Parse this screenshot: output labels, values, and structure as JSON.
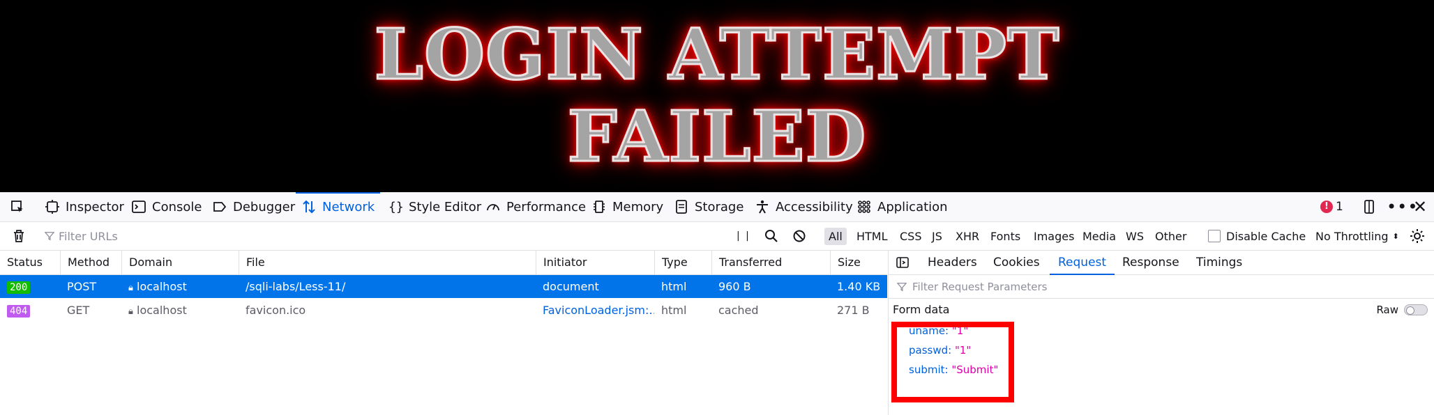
{
  "banner": {
    "line1": "LOGIN ATTEMPT",
    "line2": "FAILED"
  },
  "toolbar": {
    "tabs": [
      {
        "label": "Inspector",
        "icon": "inspector-icon"
      },
      {
        "label": "Console",
        "icon": "console-icon"
      },
      {
        "label": "Debugger",
        "icon": "debugger-icon"
      },
      {
        "label": "Network",
        "icon": "network-icon",
        "selected": true
      },
      {
        "label": "Style Editor",
        "icon": "style-editor-icon"
      },
      {
        "label": "Performance",
        "icon": "performance-icon"
      },
      {
        "label": "Memory",
        "icon": "memory-icon"
      },
      {
        "label": "Storage",
        "icon": "storage-icon"
      },
      {
        "label": "Accessibility",
        "icon": "accessibility-icon"
      },
      {
        "label": "Application",
        "icon": "application-icon"
      }
    ],
    "error_count": "1"
  },
  "filterbar": {
    "placeholder": "Filter URLs",
    "types": [
      "All",
      "HTML",
      "CSS",
      "JS",
      "XHR",
      "Fonts",
      "Images",
      "Media",
      "WS",
      "Other"
    ],
    "selected_type": "All",
    "disable_cache_label": "Disable Cache",
    "throttling": "No Throttling"
  },
  "table": {
    "columns": [
      "Status",
      "Method",
      "Domain",
      "File",
      "Initiator",
      "Type",
      "Transferred",
      "Size"
    ],
    "rows": [
      {
        "status": "200",
        "method": "POST",
        "domain": "localhost",
        "file": "/sqli-labs/Less-11/",
        "initiator": "document",
        "type": "html",
        "transferred": "960 B",
        "size": "1.40 KB"
      },
      {
        "status": "404",
        "method": "GET",
        "domain": "localhost",
        "file": "favicon.ico",
        "initiator": "FaviconLoader.jsm:…",
        "type": "html",
        "transferred": "cached",
        "size": "271 B"
      }
    ]
  },
  "details": {
    "tabs": [
      "Headers",
      "Cookies",
      "Request",
      "Response",
      "Timings"
    ],
    "selected_tab": "Request",
    "filter_placeholder": "Filter Request Parameters",
    "section_title": "Form data",
    "raw_label": "Raw",
    "form_data": [
      {
        "key": "uname:",
        "value": "\"1\""
      },
      {
        "key": "passwd:",
        "value": "\"1\""
      },
      {
        "key": "submit:",
        "value": "\"Submit\""
      }
    ]
  },
  "colors": {
    "accent": "#0061e0",
    "selected_row": "#0074e8",
    "status_200": "#12bc00",
    "status_404": "#c05bf0",
    "highlight_box": "#ff0000",
    "value_text": "#dd00a9"
  }
}
